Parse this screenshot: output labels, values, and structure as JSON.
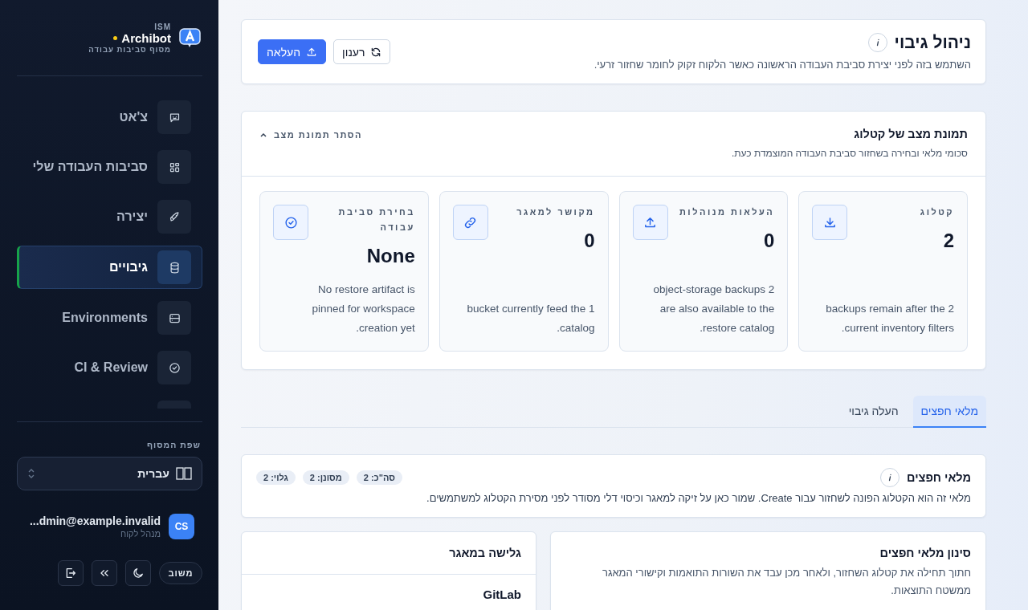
{
  "sidebar": {
    "brand": {
      "eyebrow": "ISM",
      "name": "Archibot",
      "subtitle": "מסוף סביבות עבודה"
    },
    "nav": [
      {
        "label": "צ'אט",
        "kind": "chat",
        "selected": false
      },
      {
        "label": "סביבות העבודה שלי",
        "kind": "grid",
        "selected": false
      },
      {
        "label": "יצירה",
        "kind": "rocket",
        "selected": false
      },
      {
        "label": "גיבויים",
        "kind": "database",
        "selected": true
      },
      {
        "label": "Environments",
        "kind": "server",
        "selected": false
      },
      {
        "label": "CI & Review",
        "kind": "check",
        "selected": false
      }
    ],
    "language": {
      "label": "שפת המסוף",
      "value": "עברית"
    },
    "user": {
      "initials": "CS",
      "email": "...dmin@example.invalid",
      "role": "מנהל לקוח"
    },
    "footer_buttons": [
      {
        "kind": "text",
        "label": "משוב"
      },
      {
        "kind": "theme"
      },
      {
        "kind": "collapse"
      },
      {
        "kind": "logout"
      }
    ]
  },
  "header": {
    "title": "ניהול גיבוי",
    "subtitle": "השתמש בזה לפני יצירת סביבת העבודה הראשונה כאשר הלקוח זקוק לחומר שחזור זרעי.",
    "buttons": [
      {
        "label": "רענון",
        "kind": "refresh",
        "primary": false
      },
      {
        "label": "העלאה",
        "kind": "upload",
        "primary": true
      }
    ]
  },
  "snapshot": {
    "title": "תמונת מצב של קטלוג",
    "subtitle": "סכומי מלאי ובחירה בשחזור סביבת העבודה המוצמדת כעת.",
    "toggle": "הסתר תמונת מצב",
    "expanded": true,
    "stats": [
      {
        "label": "קטלוג",
        "value": "2",
        "description": "2 backups remain after the current inventory filters.",
        "kind": "download"
      },
      {
        "label": "העלאות מנוהלות",
        "value": "0",
        "description": "2 object-storage backups are also available to the restore catalog.",
        "kind": "upload"
      },
      {
        "label": "מקושר למאגר",
        "value": "0",
        "description": "1 bucket currently feed the catalog.",
        "kind": "link"
      },
      {
        "label": "בחירת סביבת עבודה",
        "value": "None",
        "description": "No restore artifact is pinned for workspace creation yet.",
        "kind": "check"
      }
    ]
  },
  "tabs": [
    {
      "label": "מלאי חפצים",
      "selected": true
    },
    {
      "label": "העלה גיבוי",
      "selected": false
    }
  ],
  "inventory": {
    "title": "מלאי חפצים",
    "description": "מלאי זה הוא הקטלוג הפונה לשחזור עבור Create. שמור כאן על זיקה למאגר וכיסוי דלי מסודר לפני מסירת הקטלוג למשתמשים.",
    "chips": [
      "סה\"כ: 2",
      "מסונן: 2",
      "גלוי: 2"
    ]
  },
  "filter_panel": {
    "title": "סינון מלאי חפצים",
    "description": "חתוך תחילה את קטלוג השחזור, ולאחר מכן עבד את השורות התואמות וקישורי המאגר ממשטח התוצאות."
  },
  "repo_panel": {
    "title": "גלישה במאגר",
    "items": [
      "GitLab"
    ]
  }
}
